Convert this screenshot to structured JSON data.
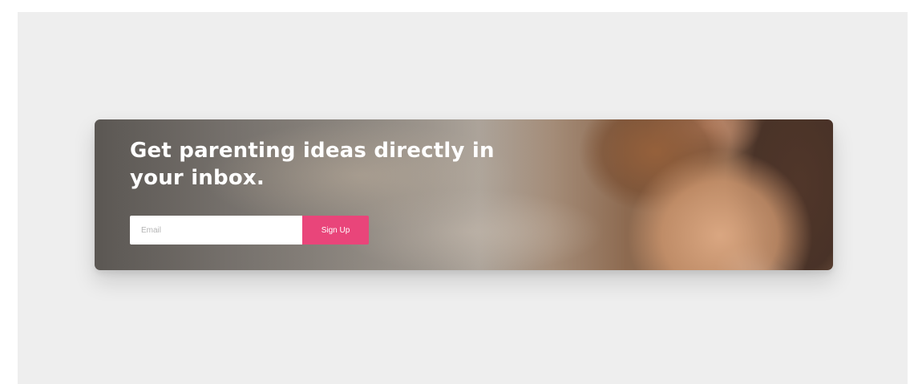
{
  "banner": {
    "headline": "Get parenting ideas directly in your inbox.",
    "email_placeholder": "Email",
    "email_value": "",
    "signup_label": "Sign Up",
    "accent_color": "#e9457a",
    "photo_alt": "child-and-parent-photo"
  }
}
